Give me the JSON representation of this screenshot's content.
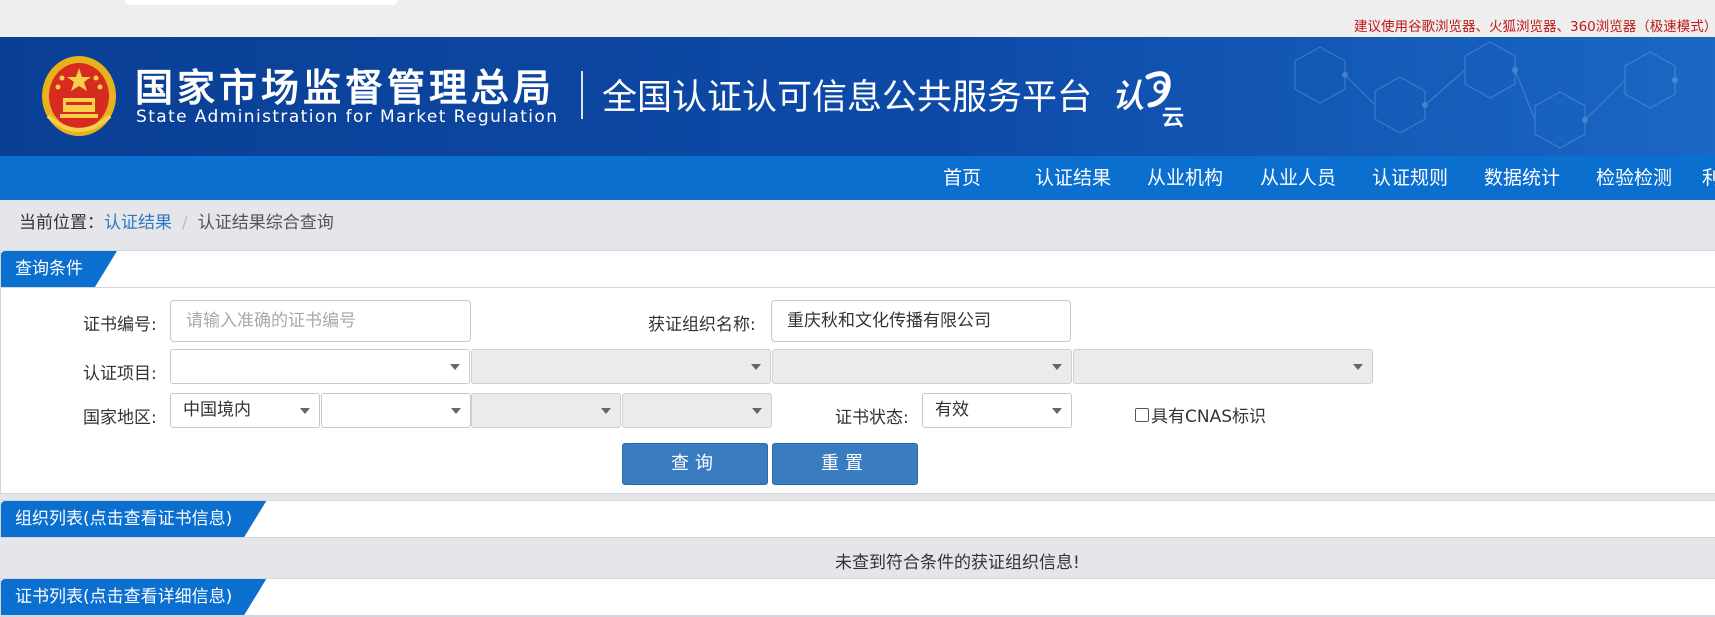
{
  "browser_notice": "建议使用谷歌浏览器、火狐浏览器、360浏览器（极速模式）",
  "header": {
    "org_cn": "国家市场监督管理总局",
    "org_en": "State Administration  for  Market Regulation",
    "platform": "全国认证认可信息公共服务平台",
    "logo_text_a": "认",
    "logo_text_b": "云"
  },
  "nav": {
    "items": [
      {
        "label": "首页"
      },
      {
        "label": "认证结果"
      },
      {
        "label": "从业机构"
      },
      {
        "label": "从业人员"
      },
      {
        "label": "认证规则"
      },
      {
        "label": "数据统计"
      },
      {
        "label": "检验检测"
      },
      {
        "label": "利"
      }
    ]
  },
  "breadcrumb": {
    "prefix": "当前位置：",
    "link": "认证结果",
    "separator": "/",
    "current": "认证结果综合查询"
  },
  "query": {
    "panel_title": "查询条件",
    "cert_no_label": "证书编号:",
    "cert_no_placeholder": "请输入准确的证书编号",
    "org_name_label": "获证组织名称:",
    "org_name_value": "重庆秋和文化传播有限公司",
    "project_label": "认证项目:",
    "region_label": "国家地区:",
    "region_value": "中国境内",
    "status_label": "证书状态:",
    "status_value": "有效",
    "cnas_label": "具有CNAS标识",
    "search_button": "查询",
    "reset_button": "重置"
  },
  "org_list": {
    "panel_title": "组织列表(点击查看证书信息)",
    "empty_message": "未查到符合条件的获证组织信息!"
  },
  "cert_list": {
    "panel_title": "证书列表(点击查看详细信息)"
  },
  "colors": {
    "banner": "#0d4aa8",
    "nav": "#0b6fd0",
    "button": "#3a7cc0",
    "notice": "#c01818",
    "link": "#2f78c5"
  }
}
